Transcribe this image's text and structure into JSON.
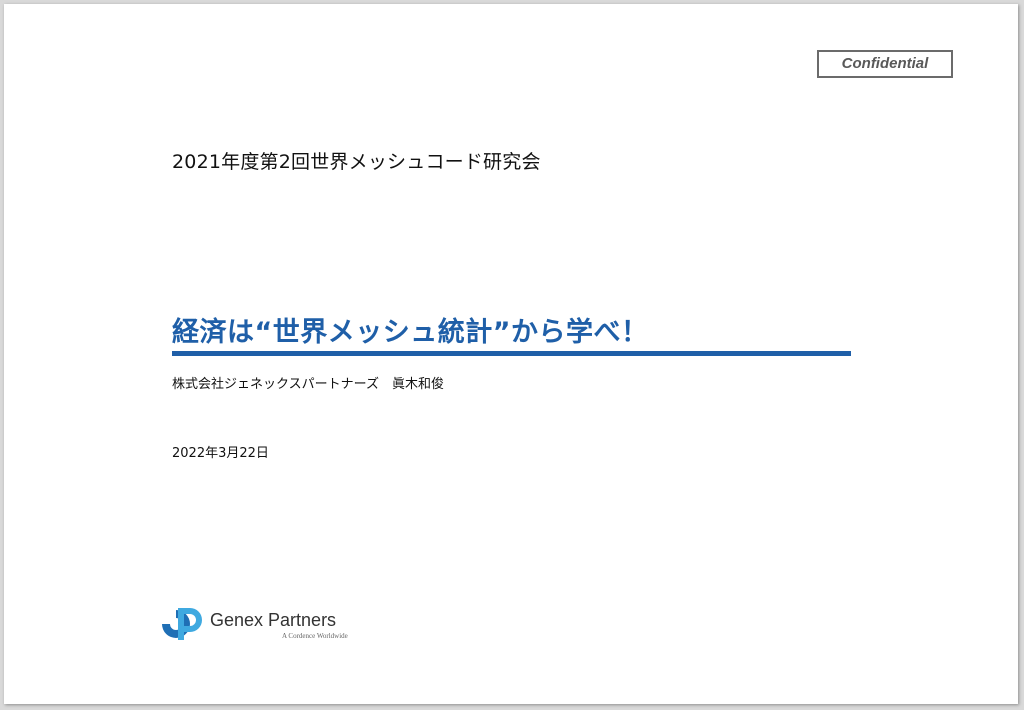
{
  "confidential_label": "Confidential",
  "event_title": "2021年度第2回世界メッシュコード研究会",
  "main_title": "経済は“世界メッシュ統計”から学べ！",
  "presenter": "株式会社ジェネックスパートナーズ　眞木和俊",
  "date": "2022年3月22日",
  "logo": {
    "name": "Genex Partners",
    "tagline": "A Cordence Worldwide",
    "icon": "genex-logo-mark"
  },
  "colors": {
    "accent": "#1f5fa8",
    "logo_dark": "#1f6fb5",
    "logo_light": "#3fa9e0"
  }
}
